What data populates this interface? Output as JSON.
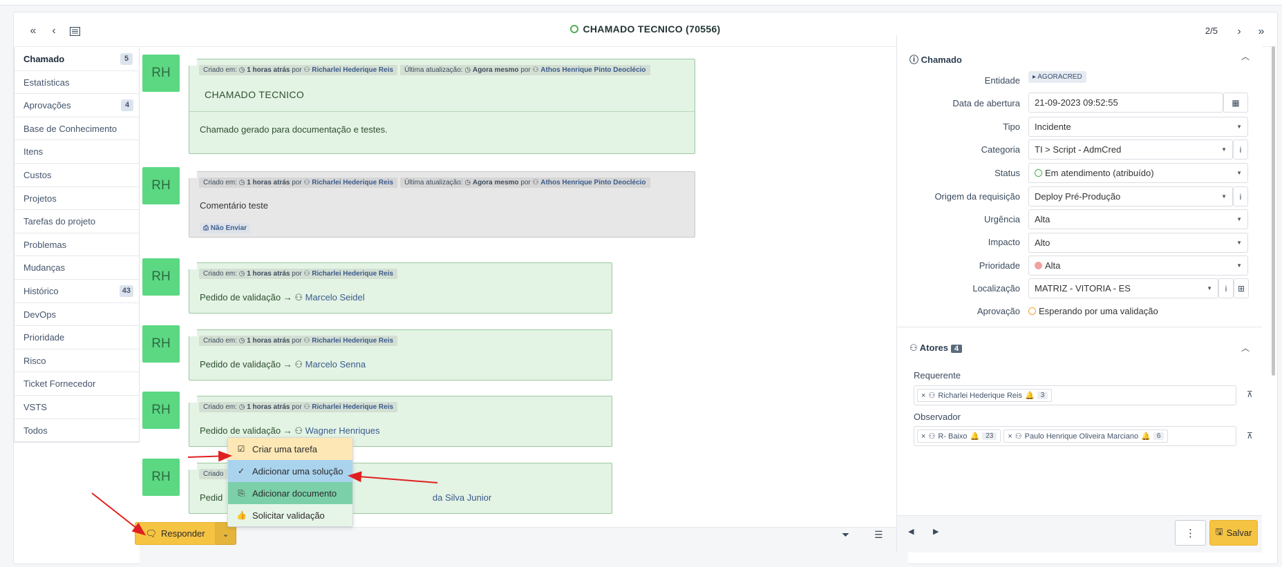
{
  "header": {
    "title": "CHAMADO TECNICO (70556)",
    "pager": "2/5",
    "icons": [
      "double-chevron-left-icon",
      "chevron-left-icon",
      "list-icon",
      "chevron-right-icon",
      "double-chevron-right-icon"
    ]
  },
  "nav": {
    "items": [
      {
        "label": "Chamado",
        "badge": "5",
        "active": true
      },
      {
        "label": "Estatísticas",
        "badge": ""
      },
      {
        "label": "Aprovações",
        "badge": "4"
      },
      {
        "label": "Base de Conhecimento",
        "badge": ""
      },
      {
        "label": "Itens",
        "badge": ""
      },
      {
        "label": "Custos",
        "badge": ""
      },
      {
        "label": "Projetos",
        "badge": ""
      },
      {
        "label": "Tarefas do projeto",
        "badge": ""
      },
      {
        "label": "Problemas",
        "badge": ""
      },
      {
        "label": "Mudanças",
        "badge": ""
      },
      {
        "label": "Histórico",
        "badge": "43"
      },
      {
        "label": "DevOps",
        "badge": ""
      },
      {
        "label": "Prioridade",
        "badge": ""
      },
      {
        "label": "Risco",
        "badge": ""
      },
      {
        "label": "Ticket Fornecedor",
        "badge": ""
      },
      {
        "label": "VSTS",
        "badge": ""
      },
      {
        "label": "Todos",
        "badge": ""
      }
    ]
  },
  "timeline": {
    "avatar": "RH",
    "labels": {
      "criado": "Criado em:",
      "ultima": "Última atualização:",
      "ago": "1 horas atrás",
      "now": "Agora mesmo",
      "por": "por"
    },
    "authors": {
      "richarlei": "Richarlei Hederique Reis",
      "athos": "Athos Henrique Pinto Deoclécio"
    },
    "items": [
      {
        "title": "CHAMADO TECNICO",
        "text": "Chamado gerado para documentação e testes."
      },
      {
        "text": "Comentário teste",
        "badge": "Não Enviar"
      },
      {
        "prefix": "Pedido de validação",
        "person": "Marcelo Seidel"
      },
      {
        "prefix": "Pedido de validação",
        "person": "Marcelo Senna"
      },
      {
        "prefix": "Pedido de validação",
        "person": "Wagner Henriques"
      },
      {
        "meta_prefix": "Criado",
        "prefix": "Pedid",
        "person": "da Silva Junior"
      }
    ]
  },
  "footer": {
    "responder": "Responder",
    "menu": [
      {
        "label": "Criar uma tarefa",
        "icon": "checkbox-icon"
      },
      {
        "label": "Adicionar uma solução",
        "icon": "check-icon"
      },
      {
        "label": "Adicionar documento",
        "icon": "document-icon"
      },
      {
        "label": "Solicitar validação",
        "icon": "thumbs-up-icon"
      }
    ],
    "save": "Salvar"
  },
  "panel": {
    "section_title": "Chamado",
    "fields": {
      "entidade_label": "Entidade",
      "entidade_value": "AGORACRED",
      "data_label": "Data de abertura",
      "data_value": "21-09-2023 09:52:55",
      "tipo_label": "Tipo",
      "tipo_value": "Incidente",
      "categoria_label": "Categoria",
      "categoria_value": "TI > Script - AdmCred",
      "status_label": "Status",
      "status_value": "Em atendimento (atribuído)",
      "origem_label": "Origem da requisição",
      "origem_value": "Deploy Pré-Produção",
      "urgencia_label": "Urgência",
      "urgencia_value": "Alta",
      "impacto_label": "Impacto",
      "impacto_value": "Alto",
      "prioridade_label": "Prioridade",
      "prioridade_value": "Alta",
      "localizacao_label": "Localização",
      "localizacao_value": "MATRIZ - VITORIA - ES",
      "aprovacao_label": "Aprovação",
      "aprovacao_value": "Esperando por uma validação"
    },
    "actors": {
      "title": "Atores",
      "count": "4",
      "requerente_label": "Requerente",
      "requerente": [
        {
          "name": "Richarlei Hederique Reis",
          "count": "3"
        }
      ],
      "observador_label": "Observador",
      "observador": [
        {
          "name": "R- Baixo",
          "count": "23"
        },
        {
          "name": "Paulo Henrique Oliveira Marciano",
          "count": "6"
        }
      ]
    }
  },
  "colors": {
    "accent": "#f6c443",
    "bubble_green": "#e3f3e4",
    "avatar": "#5cd883",
    "arrow_red": "#e02020"
  }
}
